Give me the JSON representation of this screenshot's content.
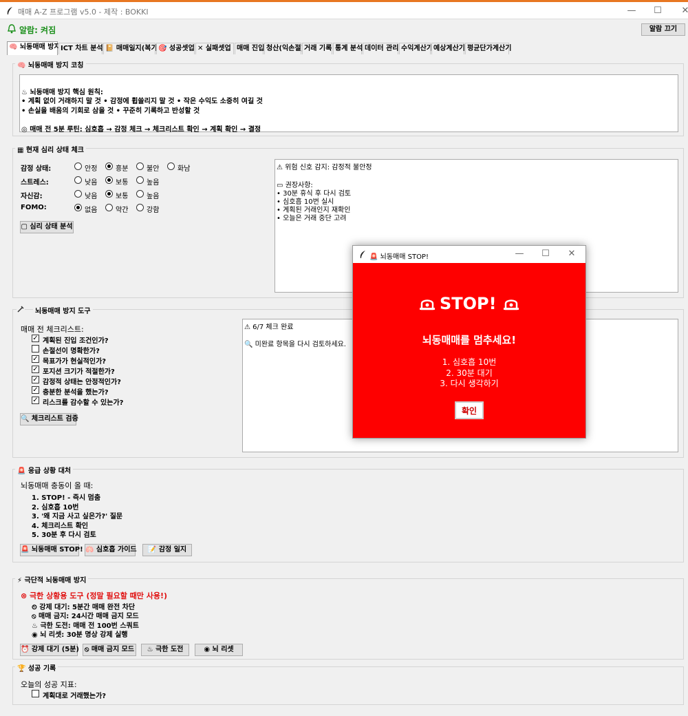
{
  "window": {
    "title": "매매 A-Z 프로그램 v5.0 - 제작 : BOKKI",
    "minimize": "—",
    "maximize": "☐",
    "close": "✕"
  },
  "alarm": {
    "status": "알람: 켜짐",
    "off_button": "알람 끄기"
  },
  "tabs": [
    "🧠 뇌동매매 방지",
    "ICT 차트 분석",
    "📔 매매일지(복기)",
    "🎯 성공셋업",
    "✕ 실패셋업",
    "매매 진입",
    "청산(익손절)",
    "거래 기록",
    "통계 분석",
    "데이터 관리",
    "수익계산기",
    "예상계산기",
    "평균단가계산기"
  ],
  "coaching": {
    "title": "🧠 뇌동매매 방지 코칭",
    "lines": [
      "♨ 뇌동매매 방지 핵심 원칙:",
      "• 계획 없이 거래하지 말 것 • 감정에 휩쓸리지 말 것 • 작은 수익도 소중히 여길 것",
      "• 손실을 배움의 기회로 삼을 것 • 꾸준히 기록하고 반성할 것",
      "",
      "◎ 매매 전 5분 루틴: 심호흡 → 감정 체크 → 체크리스트 확인 → 계획 확인 → 결정"
    ]
  },
  "mental": {
    "title": "▦ 현재 심리 상태 체크",
    "rows": [
      {
        "label": "감정 상태:",
        "options": [
          "안정",
          "흥분",
          "불안",
          "화남"
        ],
        "selected": 1
      },
      {
        "label": "스트레스:",
        "options": [
          "낮음",
          "보통",
          "높음"
        ],
        "selected": 1
      },
      {
        "label": "자신감:",
        "options": [
          "낮음",
          "보통",
          "높음"
        ],
        "selected": 1
      },
      {
        "label": "FOMO:",
        "options": [
          "없음",
          "약간",
          "강함"
        ],
        "selected": 0
      }
    ],
    "analyze_button": "▢ 심리 상태 분석",
    "result_lines": [
      "⚠ 위험 신호 감지: 감정적 불안정",
      "",
      "▭ 권장사항:",
      "• 30분 휴식 후 다시 검토",
      "• 심호흡 10번 실시",
      "• 계획된 거래인지 재확인",
      "• 오늘은 거래 중단 고려"
    ]
  },
  "tools": {
    "title": "뇌동매매 방지 도구",
    "checklist_title": "매매 전 체크리스트:",
    "items": [
      {
        "label": "계획된 진입 조건인가?",
        "checked": true
      },
      {
        "label": "손절선이 명확한가?",
        "checked": false
      },
      {
        "label": "목표가가 현실적인가?",
        "checked": true
      },
      {
        "label": "포지션 크기가 적절한가?",
        "checked": true
      },
      {
        "label": "감정적 상태는 안정적인가?",
        "checked": true
      },
      {
        "label": "충분한 분석을 했는가?",
        "checked": true
      },
      {
        "label": "리스크를 감수할 수 있는가?",
        "checked": true
      }
    ],
    "verify_button": "🔍 체크리스트 검증",
    "result_lines": [
      "⚠ 6/7 체크 완료",
      "",
      "🔍 미완료 항목을 다시 검토하세요."
    ]
  },
  "emergency": {
    "title": "🚨 응급 상황 대처",
    "heading": "뇌동매매 충동이 올 때:",
    "steps": [
      "1. STOP! - 즉시 멈춤",
      "2. 심호흡 10번",
      "3. '왜 지금 사고 싶은가?' 질문",
      "4. 체크리스트 확인",
      "5. 30분 후 다시 검토"
    ],
    "buttons": [
      "🚨 뇌동매매 STOP!",
      "🫁 심호흡 가이드",
      "📝 감정 일지"
    ]
  },
  "extreme": {
    "title": "⚡ 극단적 뇌동매매 방지",
    "warning": "⊗ 극한 상황용 도구 (정말 필요할 때만 사용!)",
    "lines": [
      "⏲ 강제 대기: 5분간 매매 완전 차단",
      "⦸ 매매 금지: 24시간 매매 금지 모드",
      "♨ 극한 도전: 매매 전 100번 스쿼트",
      "◉ 뇌 리셋: 30분 명상 강제 실행"
    ],
    "buttons": [
      "⏰ 강제 대기 (5분)",
      "⦸ 매매 금지 모드",
      "♨ 극한 도전",
      "◉ 뇌 리셋"
    ]
  },
  "success": {
    "title": "🏆 성공 기록",
    "heading": "오늘의 성공 지표:",
    "item": "계획대로 거래했는가?"
  },
  "popup": {
    "title": "🚨 뇌동매매 STOP!",
    "headline": "STOP!",
    "message": "뇌동매매를 멈추세요!",
    "steps": [
      "1. 심호흡 10번",
      "2. 30분 대기",
      "3. 다시 생각하기"
    ],
    "ok_button": "확인",
    "bg_color": "#fe0000"
  }
}
